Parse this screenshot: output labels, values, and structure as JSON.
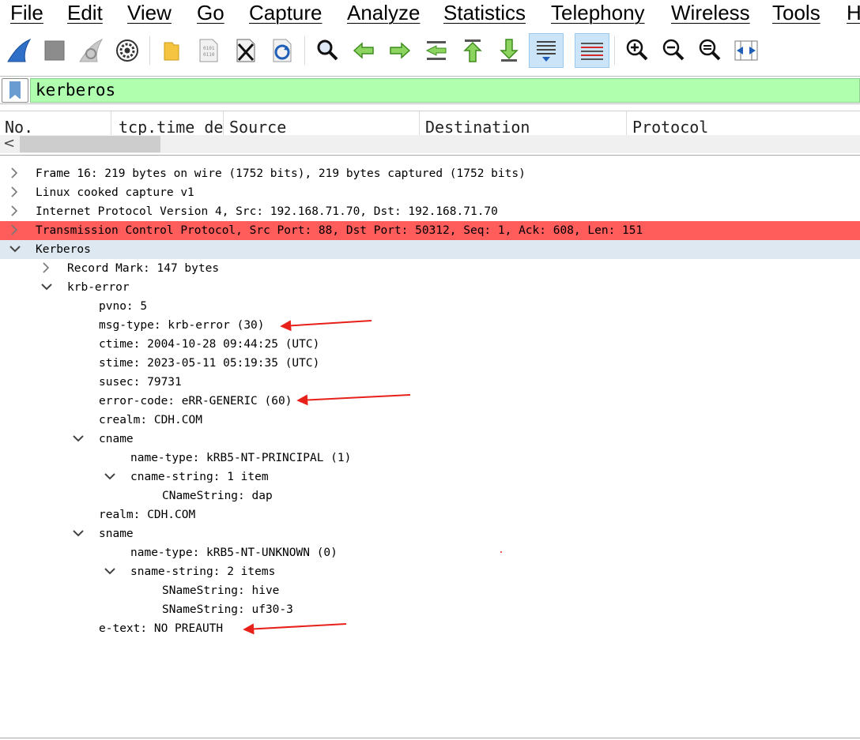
{
  "menu": [
    "File",
    "Edit",
    "View",
    "Go",
    "Capture",
    "Analyze",
    "Statistics",
    "Telephony",
    "Wireless",
    "Tools",
    "H"
  ],
  "toolbar": {
    "buttons": [
      "start-capture",
      "stop-capture",
      "restart-capture",
      "capture-options",
      "open-file",
      "save-file",
      "close-file",
      "reload-file",
      "find-packet",
      "go-back",
      "go-forward",
      "go-to-packet",
      "first-packet",
      "last-packet",
      "auto-scroll",
      "colorize",
      "zoom-in",
      "zoom-out",
      "normal-size",
      "resize-columns"
    ]
  },
  "filter": {
    "value": "kerberos"
  },
  "packet_list": {
    "columns": [
      "No.",
      "tcp.time_de",
      "Source",
      "Destination",
      "Protocol"
    ],
    "scroll_left_glyph": "<"
  },
  "details": [
    {
      "text": "Frame 16: 219 bytes on wire (1752 bits), 219 bytes captured (1752 bits)",
      "level": 0,
      "expander": "collapsed"
    },
    {
      "text": "Linux cooked capture v1",
      "level": 0,
      "expander": "collapsed"
    },
    {
      "text": "Internet Protocol Version 4, Src: 192.168.71.70, Dst: 192.168.71.70",
      "level": 0,
      "expander": "collapsed"
    },
    {
      "text": "Transmission Control Protocol, Src Port: 88, Dst Port: 50312, Seq: 1, Ack: 608, Len: 151",
      "level": 0,
      "expander": "collapsed",
      "highlight": "#ff5c5c"
    },
    {
      "text": "Kerberos",
      "level": 0,
      "expander": "expanded",
      "highlight": "#dde8f1"
    },
    {
      "text": "Record Mark: 147 bytes",
      "level": 1,
      "expander": "collapsed"
    },
    {
      "text": "krb-error",
      "level": 1,
      "expander": "expanded"
    },
    {
      "text": "pvno: 5",
      "level": 2,
      "expander": "none"
    },
    {
      "text": "msg-type: krb-error (30)",
      "level": 2,
      "expander": "none"
    },
    {
      "text": "ctime: 2004-10-28 09:44:25 (UTC)",
      "level": 2,
      "expander": "none"
    },
    {
      "text": "stime: 2023-05-11 05:19:35 (UTC)",
      "level": 2,
      "expander": "none"
    },
    {
      "text": "susec: 79731",
      "level": 2,
      "expander": "none"
    },
    {
      "text": "error-code: eRR-GENERIC (60)",
      "level": 2,
      "expander": "none"
    },
    {
      "text": "crealm: CDH.COM",
      "level": 2,
      "expander": "none"
    },
    {
      "text": "cname",
      "level": 2,
      "expander": "expanded"
    },
    {
      "text": "name-type: kRB5-NT-PRINCIPAL (1)",
      "level": 3,
      "expander": "none"
    },
    {
      "text": "cname-string: 1 item",
      "level": 3,
      "expander": "expanded"
    },
    {
      "text": "CNameString: dap",
      "level": 4,
      "expander": "none"
    },
    {
      "text": "realm: CDH.COM",
      "level": 2,
      "expander": "none"
    },
    {
      "text": "sname",
      "level": 2,
      "expander": "expanded"
    },
    {
      "text": "name-type: kRB5-NT-UNKNOWN (0)",
      "level": 3,
      "expander": "none"
    },
    {
      "text": "sname-string: 2 items",
      "level": 3,
      "expander": "expanded"
    },
    {
      "text": "SNameString: hive",
      "level": 4,
      "expander": "none"
    },
    {
      "text": "SNameString: uf30-3",
      "level": 4,
      "expander": "none"
    },
    {
      "text": "e-text: NO PREAUTH",
      "level": 2,
      "expander": "none"
    }
  ],
  "colors": {
    "filter_bg": "#afffaf",
    "error_row": "#ff5c5c",
    "selected_row": "#dde8f1",
    "annotation": "#e8201a"
  }
}
